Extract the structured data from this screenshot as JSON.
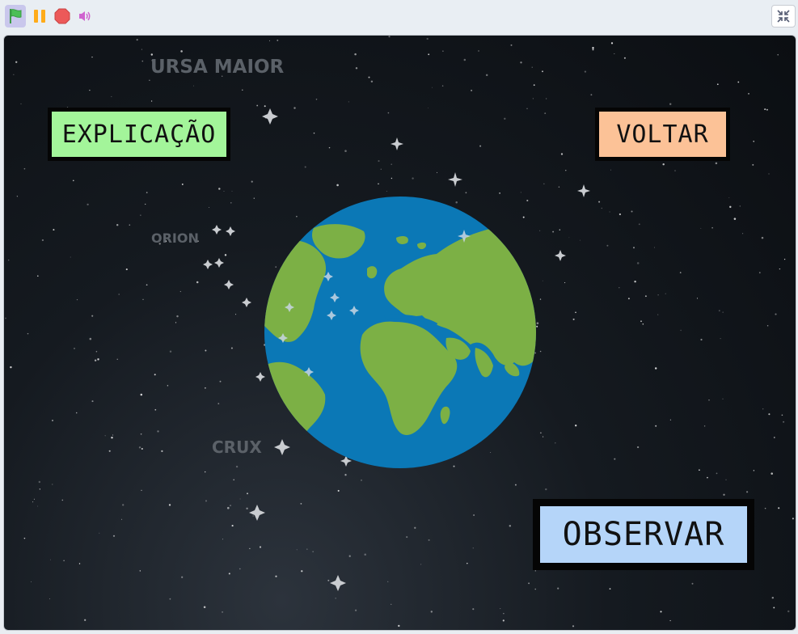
{
  "toolbar": {
    "icons": [
      "green-flag-icon",
      "pause-icon",
      "stop-icon",
      "sound-icon",
      "exit-fullscreen-icon"
    ],
    "colors": {
      "flag": "#4cbf56",
      "pause": "#ffab19",
      "stop": "#ec5959",
      "sound": "#cf63cf"
    }
  },
  "stage": {
    "constellations": {
      "ursa_maior": "URSA MAIOR",
      "orion": "ORION",
      "crux": "CRUX"
    },
    "buttons": {
      "explicacao": "EXPLICAÇÃO",
      "voltar": "VOLTAR",
      "observar": "OBSERVAR"
    },
    "colors": {
      "explicacao_bg": "#a3f59a",
      "voltar_bg": "#fcc297",
      "observar_bg": "#b5d5f9",
      "ocean": "#0b78b6",
      "land": "#7cb045"
    }
  }
}
